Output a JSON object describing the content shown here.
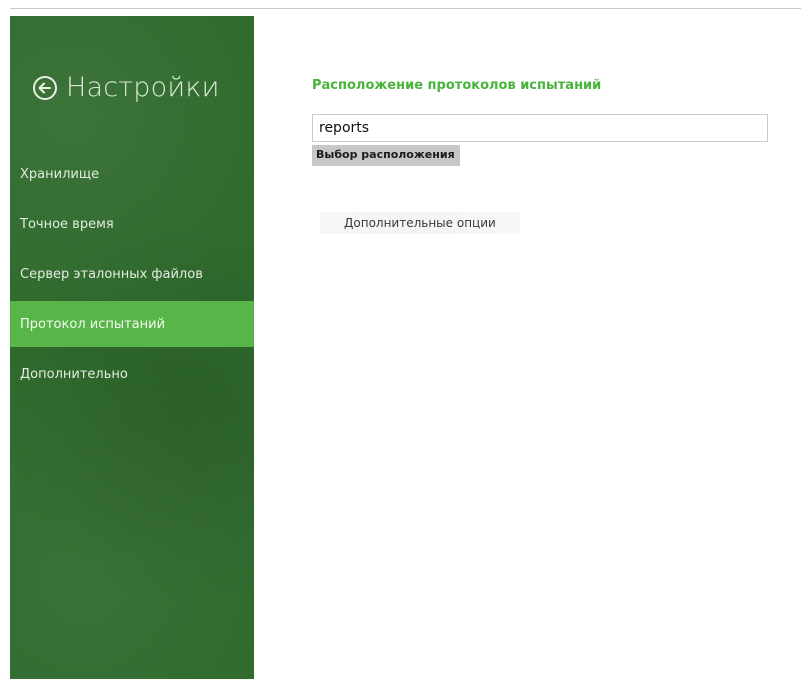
{
  "sidebar": {
    "title": "Настройки",
    "back_icon": "arrow-left-circle-icon",
    "items": [
      {
        "label": "Хранилище",
        "selected": false
      },
      {
        "label": "Точное время",
        "selected": false
      },
      {
        "label": "Сервер эталонных файлов",
        "selected": false
      },
      {
        "label": "Протокол испытаний",
        "selected": true
      },
      {
        "label": "Дополнительно",
        "selected": false
      }
    ]
  },
  "main": {
    "section_title": "Расположение протоколов испытаний",
    "path_value": "reports",
    "choose_location_label": "Выбор расположения",
    "extra_options_label": "Дополнительные опции"
  },
  "colors": {
    "sidebar_bg": "#2f6a2c",
    "selected_bg": "#58b548",
    "accent": "#48b43a"
  }
}
